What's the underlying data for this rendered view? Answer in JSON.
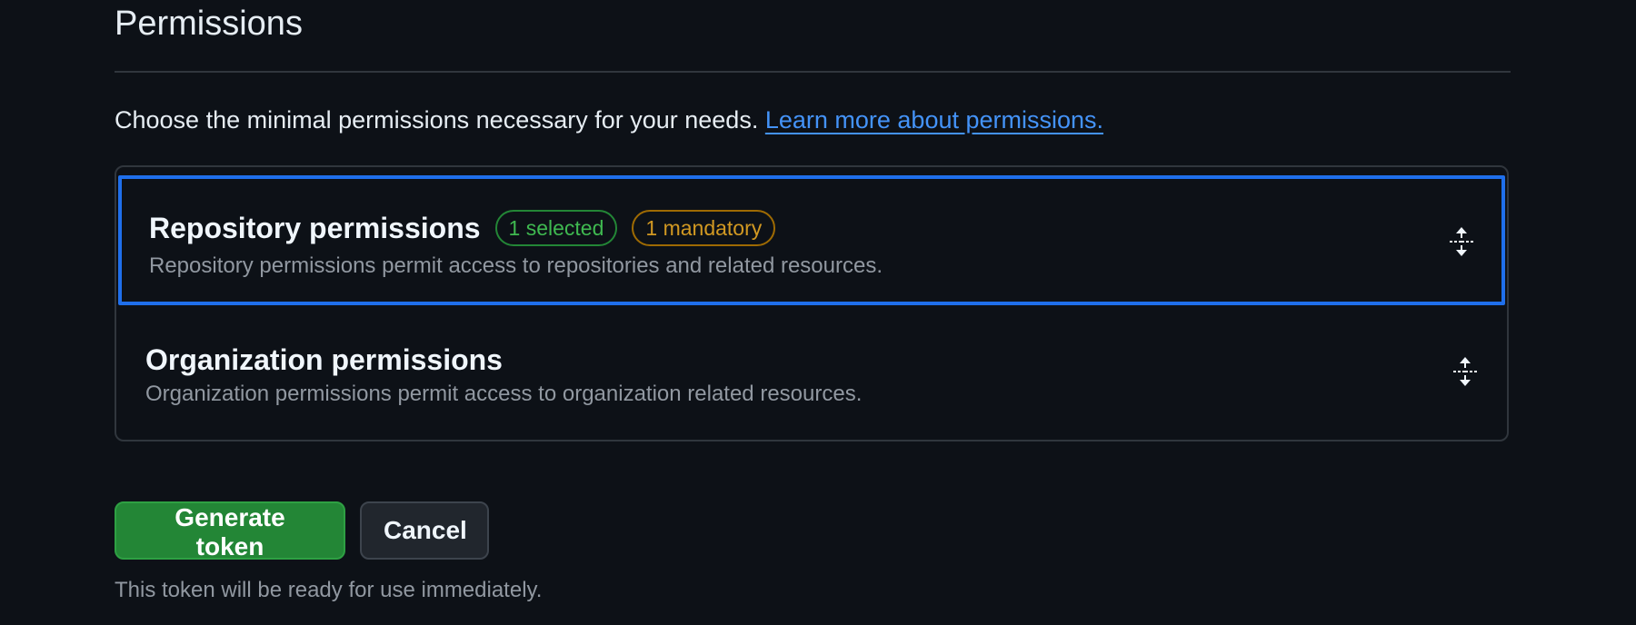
{
  "section": {
    "title": "Permissions",
    "intro_text": "Choose the minimal permissions necessary for your needs.",
    "learn_more_link": "Learn more about permissions."
  },
  "permissions": {
    "repository": {
      "title": "Repository permissions",
      "badge_selected": "1 selected",
      "badge_mandatory": "1 mandatory",
      "description": "Repository permissions permit access to repositories and related resources.",
      "icon": "unfold-icon"
    },
    "organization": {
      "title": "Organization permissions",
      "description": "Organization permissions permit access to organization related resources.",
      "icon": "unfold-icon"
    }
  },
  "actions": {
    "generate_label": "Generate token",
    "cancel_label": "Cancel",
    "note": "This token will be ready for use immediately."
  },
  "colors": {
    "background": "#0d1117",
    "link": "#4493f8",
    "focus_border": "#1f6feb",
    "primary_button": "#238636",
    "badge_green": "#3fb950",
    "badge_orange": "#d29922"
  }
}
